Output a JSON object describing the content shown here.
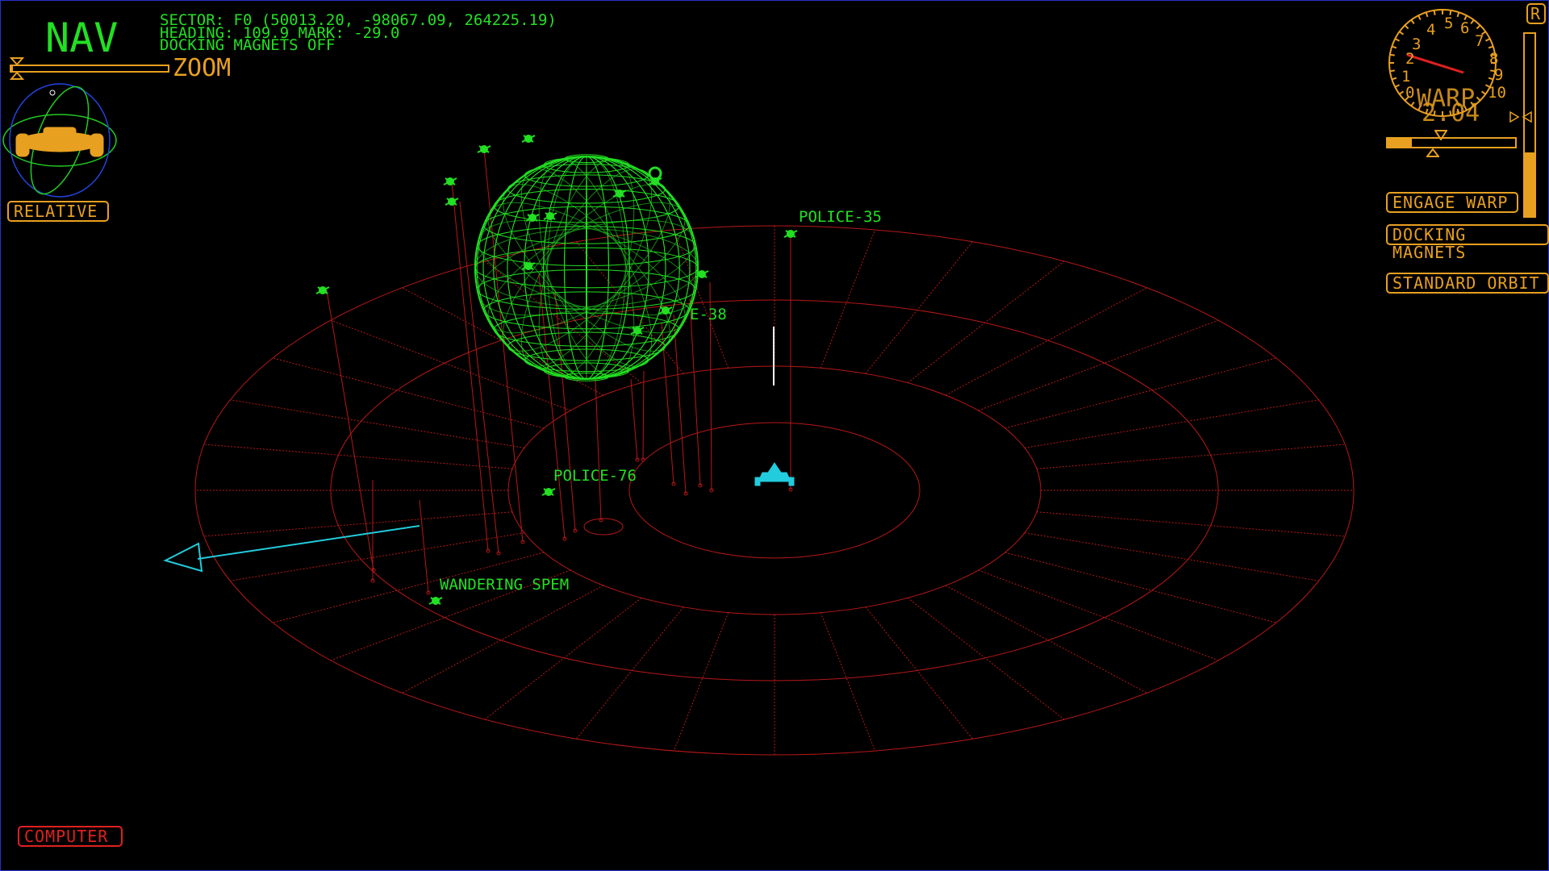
{
  "screen": {
    "title": "NAV"
  },
  "status": {
    "sector": "SECTOR: F0 (50013.20, -98067.09, 264225.19)",
    "heading": "HEADING: 109.9 MARK: -29.0",
    "docking": "DOCKING MAGNETS OFF"
  },
  "zoom": {
    "label": "ZOOM",
    "level": 0.02
  },
  "buttons": {
    "relative": "RELATIVE",
    "engage_warp": "ENGAGE WARP",
    "docking_magnets": "DOCKING MAGNETS",
    "standard_orbit": "STANDARD ORBIT",
    "computer": "COMPUTER",
    "r": "R"
  },
  "warp": {
    "label": "WARP",
    "value": "2.04",
    "dial_numbers": [
      "0",
      "1",
      "2",
      "3",
      "4",
      "5",
      "6",
      "7",
      "8",
      "9",
      "10"
    ],
    "bar_level": 0.2,
    "vertical_level": 0.35
  },
  "contacts": [
    {
      "name": "POLICE-35"
    },
    {
      "name": "POLICE-38",
      "visible_text": "E-38"
    },
    {
      "name": "POLICE-76"
    },
    {
      "name": "WANDERING SPEM"
    }
  ],
  "colors": {
    "hud_green": "#22e022",
    "hud_orange": "#e8a020",
    "grid_red": "#c01818",
    "player_cyan": "#22ccdd",
    "border_blue": "#2233cc"
  }
}
